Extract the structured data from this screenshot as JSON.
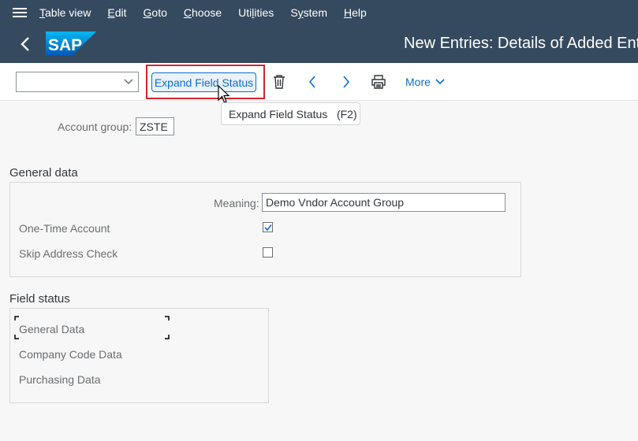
{
  "menubar": {
    "items": [
      {
        "label": "Table view",
        "underline": "T"
      },
      {
        "label": "Edit",
        "underline": "E"
      },
      {
        "label": "Goto",
        "underline": "G"
      },
      {
        "label": "Choose",
        "underline": "C"
      },
      {
        "label": "Utilities",
        "underline": "l"
      },
      {
        "label": "System",
        "underline": "y"
      },
      {
        "label": "Help",
        "underline": "H"
      }
    ]
  },
  "shell": {
    "logo_text": "SAP",
    "title": "New Entries: Details of Added Entries"
  },
  "toolbar": {
    "dropdown_value": "",
    "expand_button_label": "Expand Field Status",
    "more_label": "More",
    "icons": [
      "delete-icon",
      "previous-icon",
      "next-icon",
      "print-icon",
      "chevron-down-icon"
    ]
  },
  "tooltip": {
    "text": "Expand Field Status   (F2)"
  },
  "form": {
    "account_group_label": "Account group:",
    "account_group_value": "ZSTE"
  },
  "general_data": {
    "title": "General data",
    "meaning_label": "Meaning:",
    "meaning_value": "Demo Vndor Account Group",
    "one_time_label": "One-Time Account",
    "one_time_checked": true,
    "skip_address_label": "Skip Address Check",
    "skip_address_checked": false
  },
  "field_status": {
    "title": "Field status",
    "items": [
      "General Data",
      "Company Code Data",
      "Purchasing Data"
    ]
  },
  "colors": {
    "shell_bg": "#354a5f",
    "accent": "#0a6ed1",
    "highlight": "#d0262e",
    "page_bg": "#f7f7f7"
  }
}
